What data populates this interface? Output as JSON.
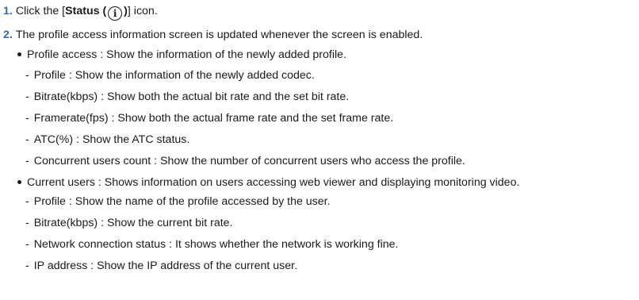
{
  "steps": [
    {
      "number": "1.",
      "text_before": "Click the [",
      "bold_label": "Status (",
      "icon": "info-icon",
      "icon_glyph": "i",
      "bold_close": ")",
      "text_after": "] icon."
    },
    {
      "number": "2.",
      "text": "The profile access information screen is updated whenever the screen is enabled."
    }
  ],
  "sections": [
    {
      "bullet": "Profile access : Show the information of the newly added profile.",
      "items": [
        "Profile : Show the information of the newly added codec.",
        "Bitrate(kbps) : Show both the actual bit rate and the set bit rate.",
        "Framerate(fps) : Show both the actual frame rate and the set frame rate.",
        "ATC(%) : Show the ATC status.",
        "Concurrent users count : Show the number of concurrent users who access the profile."
      ]
    },
    {
      "bullet": "Current users : Shows information on users accessing web viewer and displaying monitoring video.",
      "items": [
        "Profile : Show the name of the profile accessed by the user.",
        "Bitrate(kbps) : Show the current bit rate.",
        "Network connection status : It shows whether the network is working fine.",
        "IP address : Show the IP address of the current user."
      ]
    }
  ],
  "dash": "-"
}
